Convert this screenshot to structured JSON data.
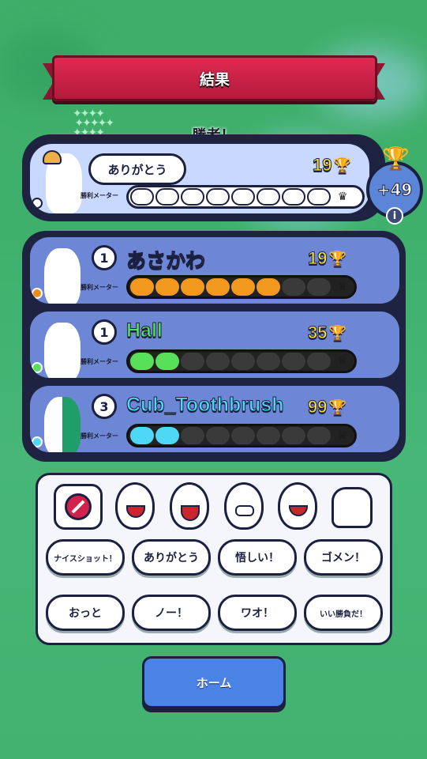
{
  "header": {
    "title": "結果",
    "winner_label": "勝者！"
  },
  "winner": {
    "message": "ありがとう",
    "meter_label": "勝利メーター",
    "score": "19",
    "reward": "+49",
    "meter_filled": 9,
    "meter_total": 9
  },
  "players": [
    {
      "rank": "1",
      "name": "あさかわ",
      "score": "19",
      "meter_label": "勝利メーター",
      "color": "#f39a1e",
      "dot_color": "#f08a18",
      "meter_filled": 6,
      "meter_total": 9
    },
    {
      "rank": "1",
      "name": "Hall",
      "score": "35",
      "meter_label": "勝利メーター",
      "color": "#59e05a",
      "dot_color": "#59e05a",
      "meter_filled": 2,
      "meter_total": 9
    },
    {
      "rank": "3",
      "name": "Cub_Toothbrush",
      "score": "99",
      "meter_label": "勝利メーター",
      "color": "#4fd8f5",
      "dot_color": "#4fd8f5",
      "meter_filled": 2,
      "meter_total": 9
    }
  ],
  "emotes": [
    "block-icon",
    "crying-face-icon",
    "laughing-face-icon",
    "grimace-face-icon",
    "shouting-face-icon",
    "thumbs-up-icon"
  ],
  "phrases": [
    "ナイスショット！",
    "ありがとう",
    "悟しい！",
    "ゴメン！",
    "おっと",
    "ノー！",
    "ワオ！",
    "いい勝負だ！"
  ],
  "home_button": "ホーム",
  "colors": {
    "accent_red": "#d2224b",
    "panel_navy": "#1d2340",
    "card_blue": "#6d86d6",
    "button_blue": "#4b82e6"
  }
}
